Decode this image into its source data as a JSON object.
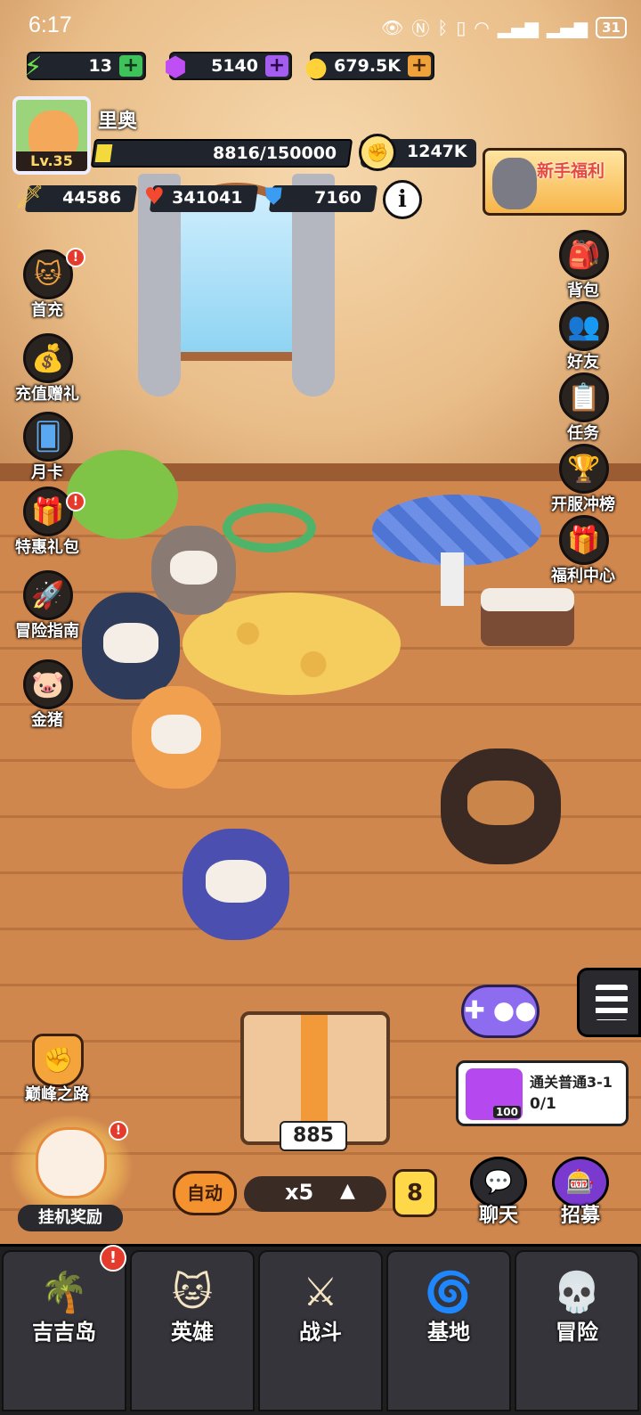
{
  "status_bar": {
    "time": "6:17",
    "battery": "31"
  },
  "resources": {
    "energy": {
      "value": "13",
      "icon": "lightning-icon"
    },
    "gems": {
      "value": "5140",
      "icon": "gem-icon"
    },
    "coins": {
      "value": "679.5K",
      "icon": "coin-icon"
    }
  },
  "player": {
    "name": "里奥",
    "level": "Lv.35",
    "xp_text": "8816/150000",
    "xp_fraction": 0.059,
    "power": "1247K",
    "attack": "44586",
    "hp": "341041",
    "defense": "7160"
  },
  "promo": {
    "title": "新手福利"
  },
  "left_menu": [
    {
      "label": "首充",
      "icon": "first-recharge-icon",
      "badge": "!"
    },
    {
      "label": "充值赠礼",
      "icon": "money-bag-icon"
    },
    {
      "label": "月卡",
      "icon": "month-card-icon"
    },
    {
      "label": "特惠礼包",
      "icon": "gift-pack-icon",
      "badge": "!"
    },
    {
      "label": "冒险指南",
      "icon": "rocket-icon"
    },
    {
      "label": "金猪",
      "icon": "gold-pig-icon"
    }
  ],
  "right_menu": [
    {
      "label": "背包",
      "icon": "backpack-icon"
    },
    {
      "label": "好友",
      "icon": "friends-icon"
    },
    {
      "label": "任务",
      "icon": "tasks-icon"
    },
    {
      "label": "开服冲榜",
      "icon": "trophy-icon"
    },
    {
      "label": "福利中心",
      "icon": "gift-box-icon"
    }
  ],
  "quest": {
    "title": "通关普通3-1",
    "progress": "0/1",
    "reward_count": "100"
  },
  "box_count": "885",
  "peak_road": {
    "label": "巅峰之路"
  },
  "idle_reward": {
    "label": "挂机奖励",
    "badge": "!"
  },
  "controls": {
    "auto": "自动",
    "speed": "x5",
    "level": "8"
  },
  "chat": {
    "label": "聊天"
  },
  "recruit": {
    "label": "招募"
  },
  "nav": [
    {
      "label": "吉吉岛",
      "icon": "palm-island-icon",
      "badge": "!"
    },
    {
      "label": "英雄",
      "icon": "hero-icon"
    },
    {
      "label": "战斗",
      "icon": "crossed-swords-icon"
    },
    {
      "label": "基地",
      "icon": "base-icon"
    },
    {
      "label": "冒险",
      "icon": "skull-icon"
    }
  ]
}
